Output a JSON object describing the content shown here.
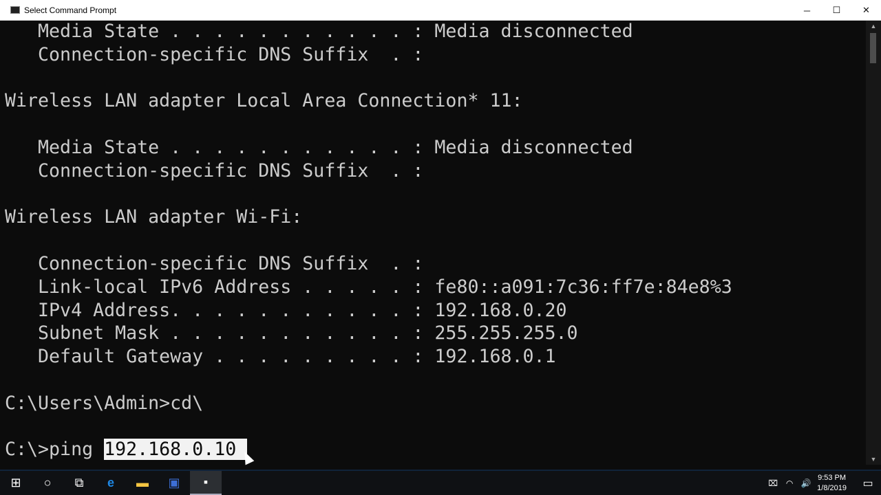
{
  "window": {
    "title": "Select Command Prompt",
    "minimize": "─",
    "maximize": "☐",
    "close": "✕"
  },
  "console": {
    "lines": [
      "   Media State . . . . . . . . . . . : Media disconnected",
      "   Connection-specific DNS Suffix  . :",
      "",
      "Wireless LAN adapter Local Area Connection* 11:",
      "",
      "   Media State . . . . . . . . . . . : Media disconnected",
      "   Connection-specific DNS Suffix  . :",
      "",
      "Wireless LAN adapter Wi-Fi:",
      "",
      "   Connection-specific DNS Suffix  . :",
      "   Link-local IPv6 Address . . . . . : fe80::a091:7c36:ff7e:84e8%3",
      "   IPv4 Address. . . . . . . . . . . : 192.168.0.20",
      "   Subnet Mask . . . . . . . . . . . : 255.255.255.0",
      "   Default Gateway . . . . . . . . . : 192.168.0.1",
      "",
      "C:\\Users\\Admin>cd\\",
      ""
    ],
    "prompt": "C:\\>ping ",
    "selected_text": "192.168.0.10 "
  },
  "taskbar": {
    "start": "⊞",
    "search": "○",
    "task_view": "⧉",
    "edge": "e",
    "explorer": "▬",
    "app": "▣",
    "cmd": "▪",
    "tray": {
      "network_status": "⌧",
      "wifi": "◠",
      "volume": "🔊",
      "time": "9:53 PM",
      "date": "1/8/2019",
      "notifications": "▭"
    }
  },
  "colors": {
    "console_bg": "#0c0c0c",
    "console_fg": "#cccccc",
    "selection": "#f2f2f2"
  }
}
